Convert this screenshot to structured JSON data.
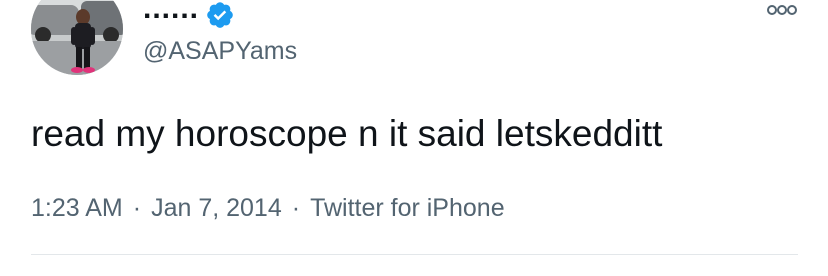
{
  "user": {
    "display_name": "......",
    "handle": "@ASAPYams",
    "verified": true,
    "avatar_icon": "profile-photo"
  },
  "tweet": {
    "text": "read my horoscope n it said letskedditt",
    "time": "1:23 AM",
    "date": "Jan 7, 2014",
    "source": "Twitter for iPhone",
    "separator": "·"
  },
  "icons": {
    "verified": "verified-badge-icon",
    "more": "more-options-icon"
  },
  "colors": {
    "verified_blue": "#1d9bf0",
    "secondary_text": "#536471",
    "primary_text": "#0f1419"
  }
}
